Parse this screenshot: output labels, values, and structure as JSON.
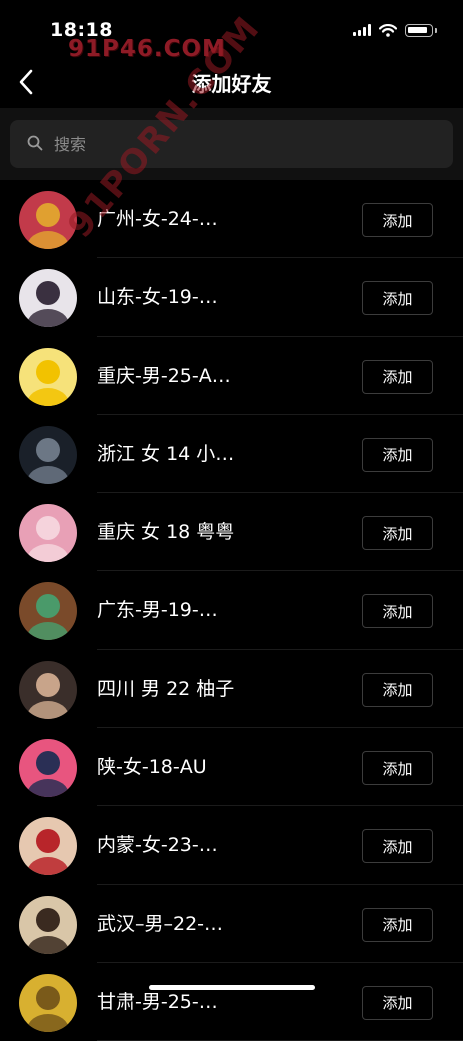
{
  "status_bar": {
    "time": "18:18",
    "icons": [
      "cellular-signal-icon",
      "wifi-icon",
      "battery-icon"
    ]
  },
  "watermarks": {
    "top": "91P46.COM",
    "diagonal": "91PORN.COM"
  },
  "nav": {
    "back_icon": "chevron-left-icon",
    "title": "添加好友"
  },
  "search": {
    "icon": "search-icon",
    "placeholder": "搜索",
    "value": ""
  },
  "friends": [
    {
      "name": "广州-女-24-…",
      "button": "添加",
      "avatar_colors": [
        "#c23a4a",
        "#e0a030"
      ]
    },
    {
      "name": "山东-女-19-…",
      "button": "添加",
      "avatar_colors": [
        "#e8e4ea",
        "#3a3040"
      ]
    },
    {
      "name": "重庆-男-25-A…",
      "button": "添加",
      "avatar_colors": [
        "#f6e27a",
        "#f2c200"
      ]
    },
    {
      "name": "浙江 女 14 小…",
      "button": "添加",
      "avatar_colors": [
        "#1a2029",
        "#6c7785"
      ]
    },
    {
      "name": "重庆 女 18 粤粤",
      "button": "添加",
      "avatar_colors": [
        "#e8a0b6",
        "#f5d3dc"
      ]
    },
    {
      "name": "广东-男-19-…",
      "button": "添加",
      "avatar_colors": [
        "#7a4a2a",
        "#4a9a6a"
      ]
    },
    {
      "name": "四川 男 22 柚子",
      "button": "添加",
      "avatar_colors": [
        "#3a2e2a",
        "#c8a48a"
      ]
    },
    {
      "name": "陕-女-18-AU",
      "button": "添加",
      "avatar_colors": [
        "#e8557f",
        "#2a2f55"
      ]
    },
    {
      "name": "内蒙-女-23-…",
      "button": "添加",
      "avatar_colors": [
        "#e6c8b0",
        "#b8252a"
      ]
    },
    {
      "name": "武汉–男–22-…",
      "button": "添加",
      "avatar_colors": [
        "#d9c6a8",
        "#3a2a20"
      ]
    },
    {
      "name": "甘肃-男-25-…",
      "button": "添加",
      "avatar_colors": [
        "#d8b030",
        "#7a5a1a"
      ]
    }
  ],
  "theme": {
    "background": "#000000",
    "search_band": "#111111",
    "search_box": "#222222",
    "watermark": "#8e1b26"
  }
}
